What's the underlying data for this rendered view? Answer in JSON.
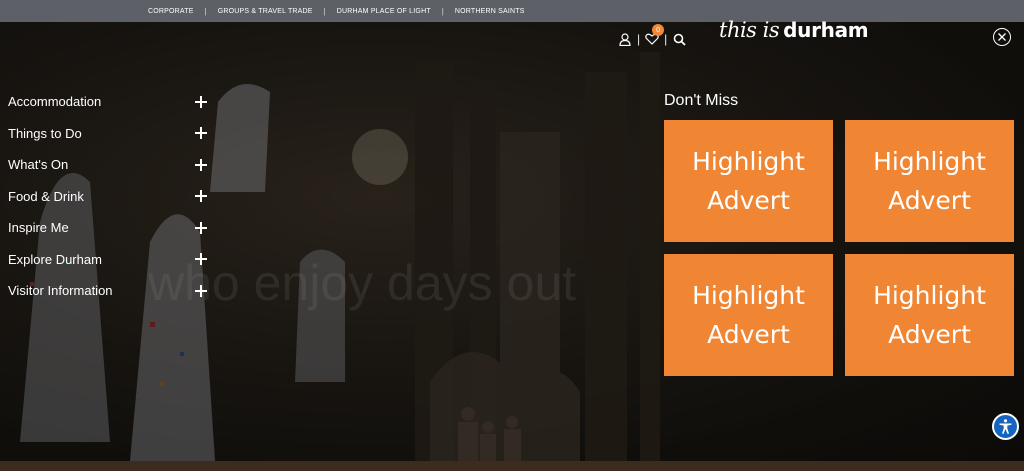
{
  "topbar": {
    "links": [
      "CORPORATE",
      "GROUPS & TRAVEL TRADE",
      "DURHAM PLACE OF LIGHT",
      "NORTHERN SAINTS"
    ],
    "separator": "|"
  },
  "header": {
    "account_icon": "user-icon",
    "wishlist_icon": "heart-icon",
    "wishlist_count": "0",
    "search_icon": "search-icon",
    "separator": "|",
    "logo": {
      "part1": "this is",
      "part2": "durham"
    },
    "close_icon": "close-icon"
  },
  "background": {
    "overlay_text": "who enjoy days out"
  },
  "menu": {
    "items": [
      {
        "label": "Accommodation"
      },
      {
        "label": "Things to Do"
      },
      {
        "label": "What's On"
      },
      {
        "label": "Food & Drink"
      },
      {
        "label": "Inspire Me"
      },
      {
        "label": "Explore Durham"
      },
      {
        "label": "Visitor Information"
      }
    ],
    "expand_icon": "plus-icon"
  },
  "dont_miss": {
    "title": "Don't Miss",
    "ads": [
      {
        "line1": "Highlight",
        "line2": "Advert"
      },
      {
        "line1": "Highlight",
        "line2": "Advert"
      },
      {
        "line1": "Highlight",
        "line2": "Advert"
      },
      {
        "line1": "Highlight",
        "line2": "Advert"
      }
    ]
  },
  "accessibility": {
    "icon": "accessibility-icon"
  },
  "colors": {
    "topbar": "#5d6067",
    "accent": "#f08533",
    "access": "#1565c0"
  }
}
